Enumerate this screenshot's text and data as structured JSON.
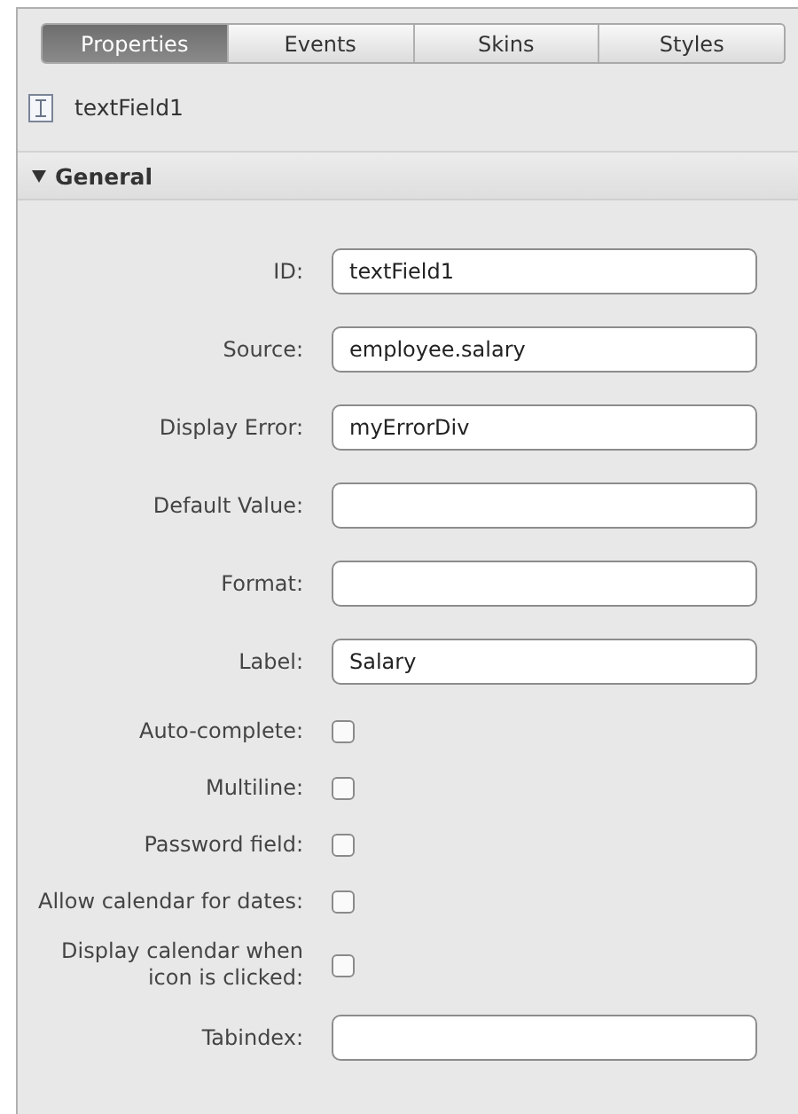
{
  "tabs": [
    {
      "label": "Properties",
      "selected": true
    },
    {
      "label": "Events",
      "selected": false
    },
    {
      "label": "Skins",
      "selected": false
    },
    {
      "label": "Styles",
      "selected": false
    }
  ],
  "component": {
    "name": "textField1"
  },
  "section": {
    "title": "General",
    "expanded": true
  },
  "fields": [
    {
      "kind": "text",
      "label": "ID:",
      "value": "textField1"
    },
    {
      "kind": "text",
      "label": "Source:",
      "value": "employee.salary"
    },
    {
      "kind": "text",
      "label": "Display Error:",
      "value": "myErrorDiv"
    },
    {
      "kind": "text",
      "label": "Default Value:"
    },
    {
      "kind": "text",
      "label": "Format:"
    },
    {
      "kind": "text",
      "label": "Label:",
      "value": "Salary"
    },
    {
      "kind": "checkbox",
      "label": "Auto-complete:",
      "checked": false
    },
    {
      "kind": "checkbox",
      "label": "Multiline:",
      "checked": false
    },
    {
      "kind": "checkbox",
      "label": "Password field:",
      "checked": false
    },
    {
      "kind": "checkbox",
      "label": "Allow calendar for dates:",
      "checked": false
    },
    {
      "kind": "checkbox",
      "label": "Display calendar when icon is clicked:",
      "checked": false
    },
    {
      "kind": "text",
      "label": "Tabindex:"
    }
  ]
}
